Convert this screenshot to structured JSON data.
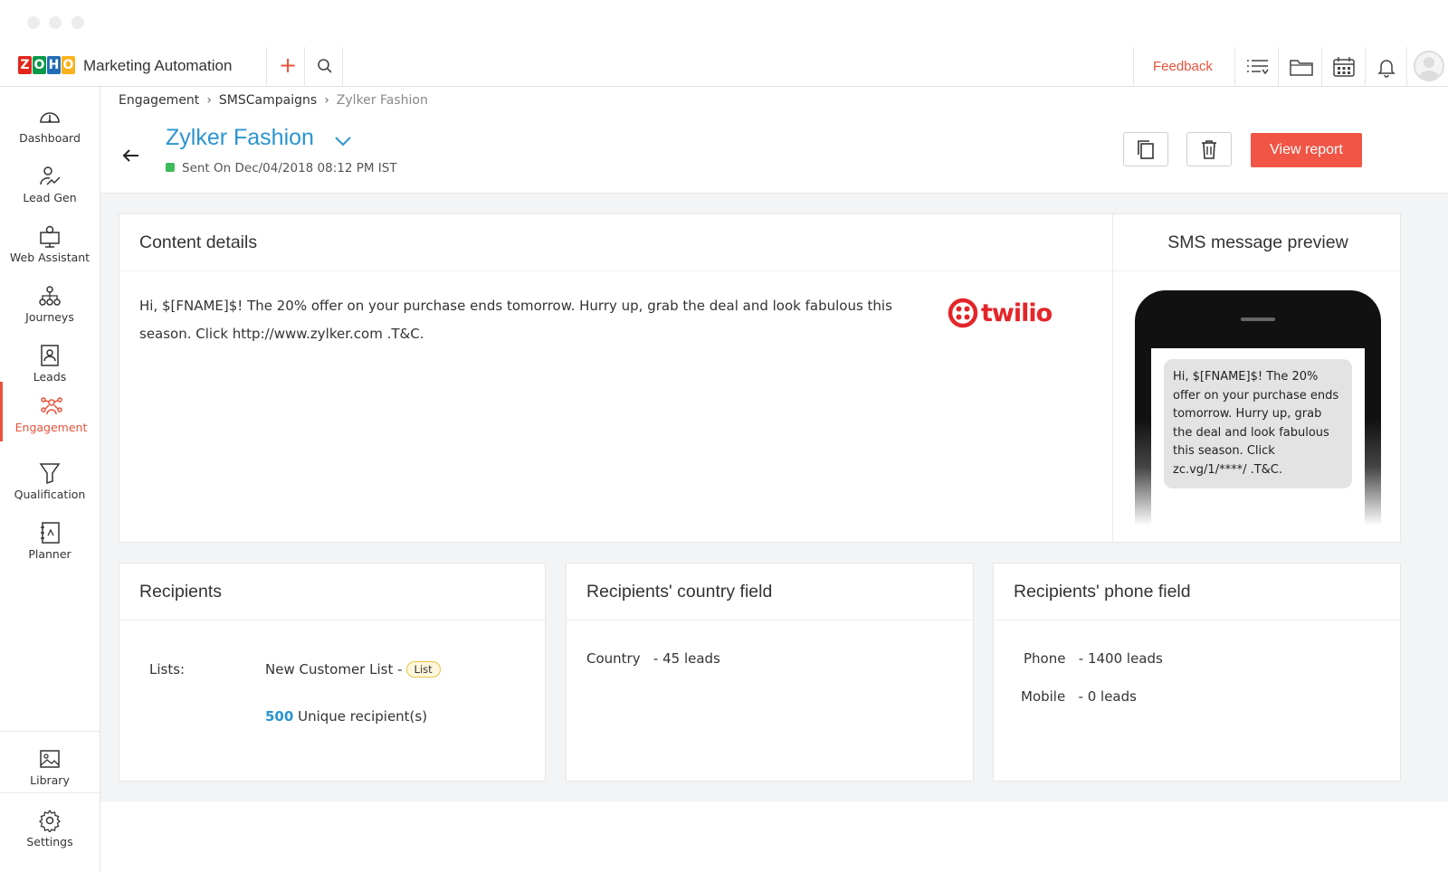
{
  "app": {
    "name": "Marketing Automation",
    "logo_letters": [
      "Z",
      "O",
      "H",
      "O"
    ],
    "logo_colors": [
      "#e2261c",
      "#089949",
      "#226db4",
      "#f9b21d"
    ],
    "accent": "#e8523b",
    "link_blue": "#2b94d1"
  },
  "topbar": {
    "feedback_label": "Feedback"
  },
  "sidebar": {
    "items": [
      {
        "label": "Dashboard",
        "icon": "gauge-icon"
      },
      {
        "label": "Lead Gen",
        "icon": "lead-gen-icon"
      },
      {
        "label": "Web Assistant",
        "icon": "web-assistant-icon"
      },
      {
        "label": "Journeys",
        "icon": "journeys-icon"
      },
      {
        "label": "Leads",
        "icon": "leads-icon"
      },
      {
        "label": "Engagement",
        "icon": "engagement-icon",
        "active": true
      },
      {
        "label": "Qualification",
        "icon": "funnel-icon"
      },
      {
        "label": "Planner",
        "icon": "planner-icon"
      }
    ],
    "bottom_items": [
      {
        "label": "Library",
        "icon": "library-icon"
      },
      {
        "label": "Settings",
        "icon": "gear-icon"
      }
    ]
  },
  "breadcrumb": {
    "items": [
      "Engagement",
      "SMSCampaigns",
      "Zylker Fashion"
    ]
  },
  "campaign": {
    "title": "Zylker Fashion",
    "status": "Sent On Dec/04/2018 08:12 PM IST",
    "view_report_label": "View report"
  },
  "content_details": {
    "title": "Content details",
    "message": "Hi, $[FNAME]$! The 20% offer on your purchase ends tomorrow. Hurry up, grab the deal and look fabulous this season. Click http://www.zylker.com .T&C.",
    "provider_logo": "twilio"
  },
  "sms_preview": {
    "title": "SMS message preview",
    "message": "Hi, $[FNAME]$! The 20% offer on your purchase ends tomorrow. Hurry up, grab the deal and look fabulous this season. Click zc.vg/1/****/ .T&C."
  },
  "recipients": {
    "title": "Recipients",
    "lists_label": "Lists:",
    "list_name": "New Customer List -",
    "list_tag": "List",
    "unique_count": "500",
    "unique_label": "Unique recipient(s)"
  },
  "country_field": {
    "title": "Recipients' country field",
    "field_label": "Country",
    "field_value": "- 45 leads"
  },
  "phone_field": {
    "title": "Recipients' phone field",
    "rows": [
      {
        "label": "Phone",
        "value": "- 1400 leads"
      },
      {
        "label": "Mobile",
        "value": "- 0 leads"
      }
    ]
  }
}
